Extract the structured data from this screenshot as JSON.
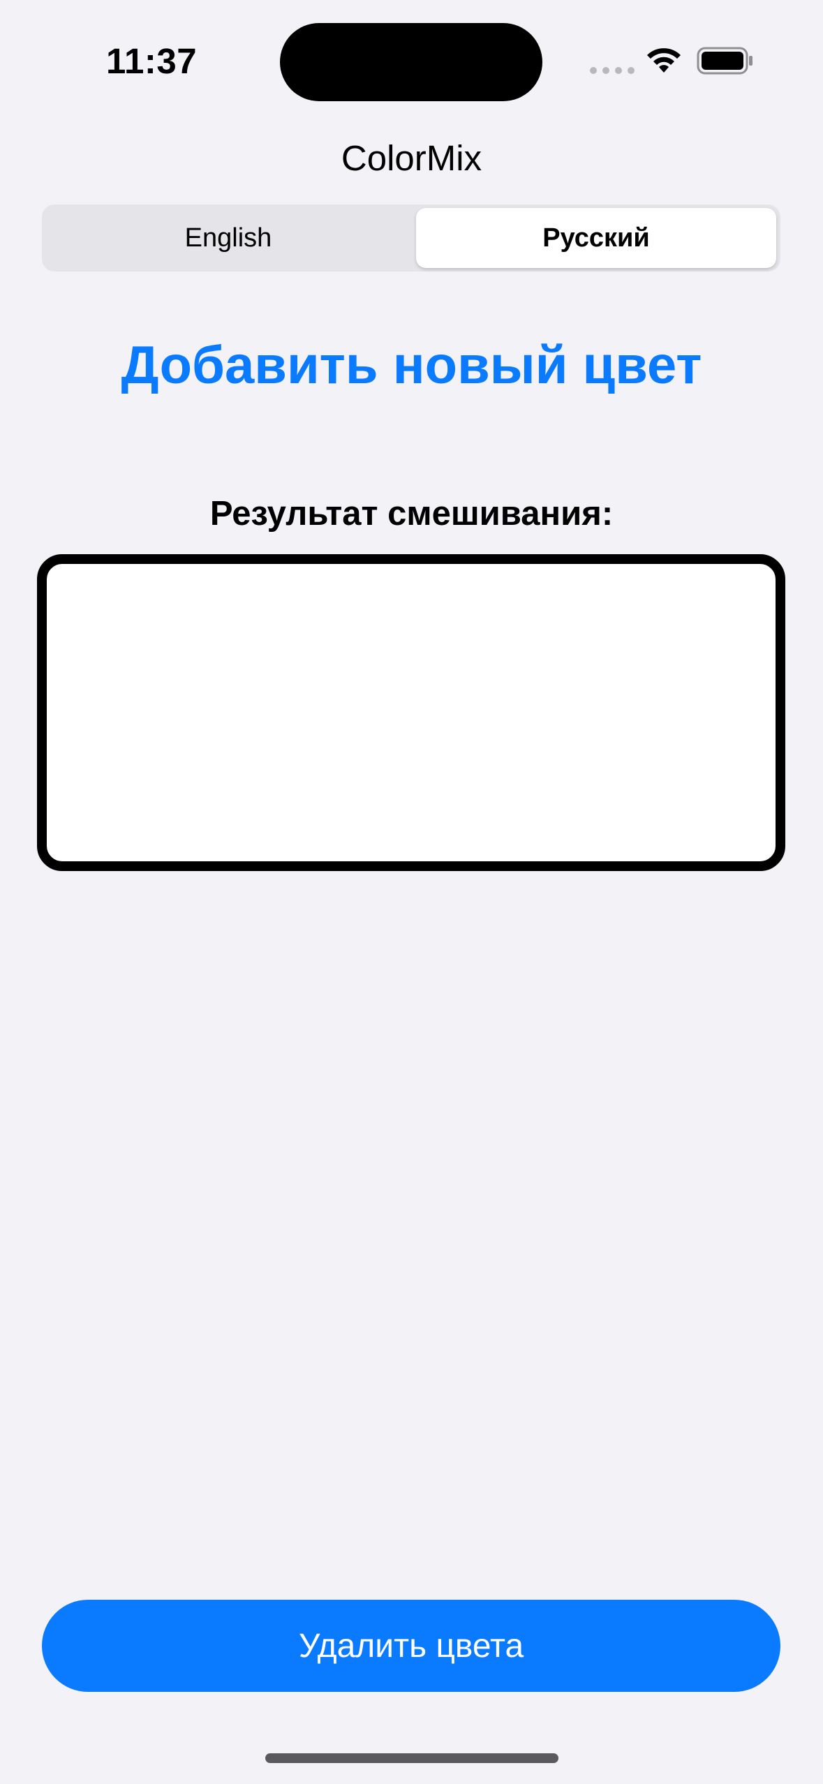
{
  "status_bar": {
    "time": "11:37",
    "icons": [
      "signal-dots-icon",
      "wifi-icon",
      "battery-icon"
    ]
  },
  "app": {
    "title": "ColorMix"
  },
  "language_selector": {
    "options": [
      "English",
      "Русский"
    ],
    "selected": "Русский"
  },
  "main": {
    "add_color_label": "Добавить новый цвет",
    "result_label": "Результат смешивания:",
    "result_color": "#ffffff"
  },
  "actions": {
    "delete_colors_label": "Удалить цвета"
  },
  "colors": {
    "accent": "#0a7aff",
    "background": "#f2f2f7",
    "segment_background": "#e4e4e9"
  }
}
